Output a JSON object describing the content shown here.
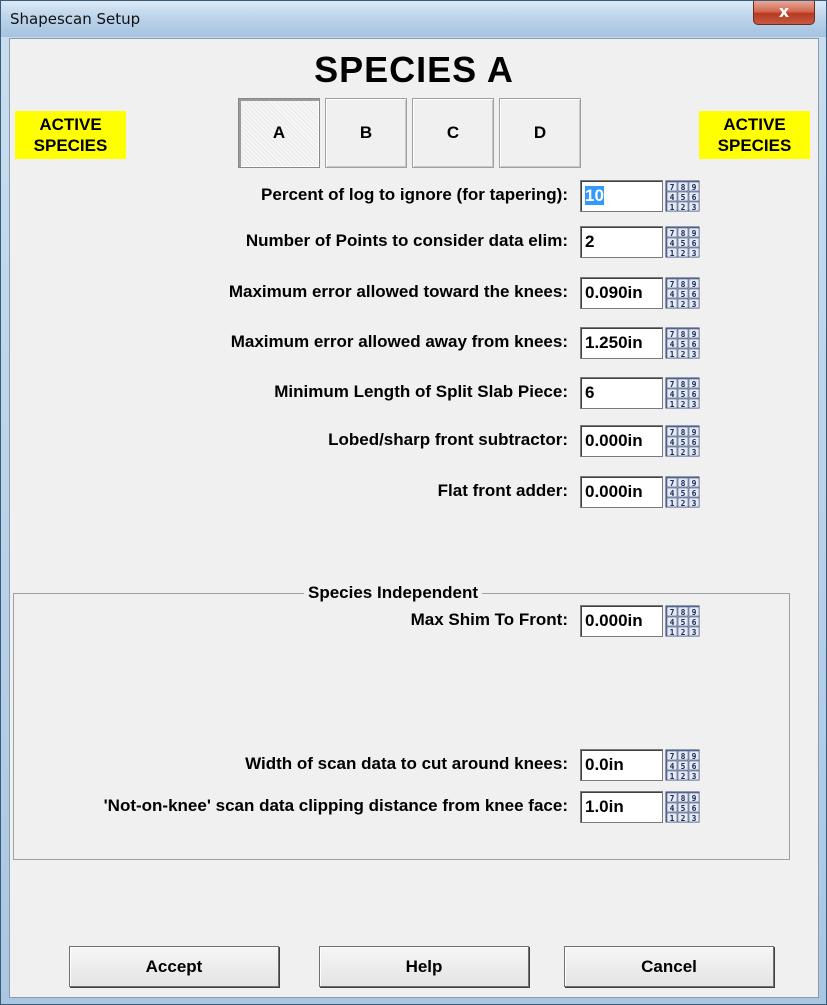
{
  "window": {
    "title": "Shapescan Setup",
    "close_glyph": "x"
  },
  "header": {
    "species_title": "SPECIES A",
    "active_left": "ACTIVE SPECIES",
    "active_right": "ACTIVE SPECIES"
  },
  "tabs": [
    {
      "label": "A",
      "selected": true
    },
    {
      "label": "B",
      "selected": false
    },
    {
      "label": "C",
      "selected": false
    },
    {
      "label": "D",
      "selected": false
    }
  ],
  "fields": [
    {
      "label": "Percent of log to ignore (for tapering):",
      "value": "10"
    },
    {
      "label": "Number of Points to consider data elim:",
      "value": "2"
    },
    {
      "label": "Maximum error allowed toward the knees:",
      "value": "0.090in"
    },
    {
      "label": "Maximum error allowed away from knees:",
      "value": "1.250in"
    },
    {
      "label": "Minimum Length of Split Slab Piece:",
      "value": "6"
    },
    {
      "label": "Lobed/sharp front subtractor:",
      "value": "0.000in"
    },
    {
      "label": "Flat front adder:",
      "value": "0.000in"
    }
  ],
  "independent": {
    "legend": "Species Independent",
    "fields": [
      {
        "label": "Max Shim To Front:",
        "value": "0.000in"
      },
      {
        "label": "Width of scan data to cut around knees:",
        "value": "0.0in"
      },
      {
        "label": "'Not-on-knee' scan data clipping distance from knee face:",
        "value": "1.0in"
      }
    ]
  },
  "numpad_icon": "keypad-icon",
  "numpad_digits": [
    "7",
    "8",
    "9",
    "4",
    "5",
    "6",
    "1",
    "2",
    "3"
  ],
  "buttons": {
    "accept": "Accept",
    "help": "Help",
    "cancel": "Cancel"
  }
}
